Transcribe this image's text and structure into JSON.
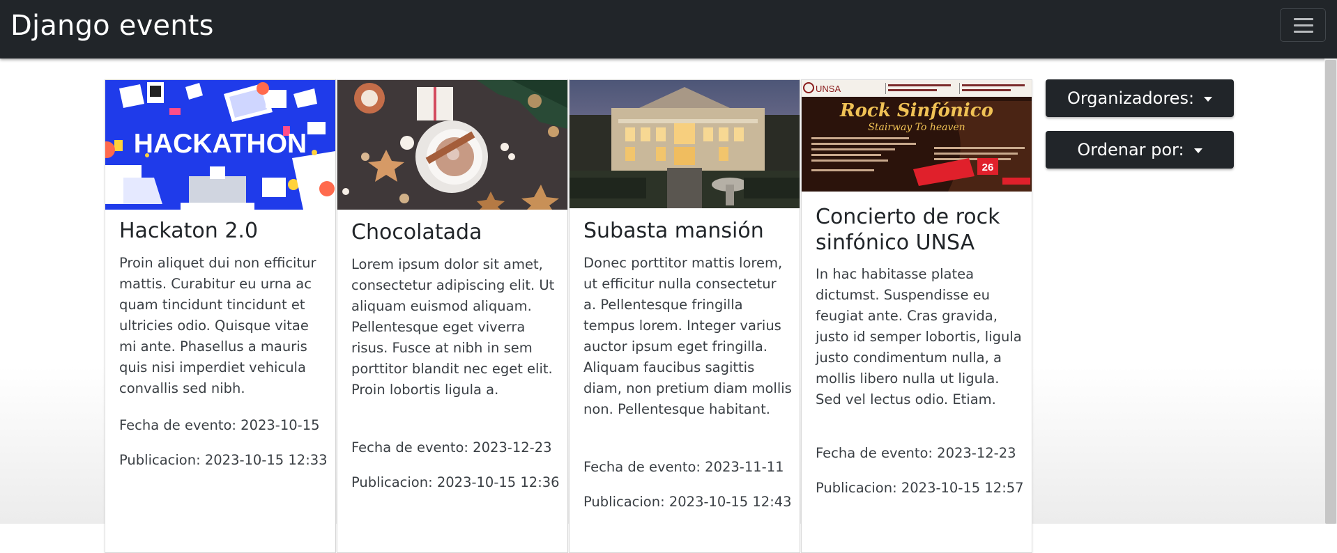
{
  "navbar": {
    "brand": "Django events",
    "toggler_icon": "hamburger-icon"
  },
  "events": [
    {
      "title": "Hackaton 2.0",
      "image": {
        "banner_text": "HACKATHON"
      },
      "description": "Proin aliquet dui non efficitur mattis. Curabitur eu urna ac quam tincidunt tincidunt et ultricies odio. Quisque vitae mi ante. Phasellus a mauris quis nisi imperdiet vehicula convallis sed nibh.",
      "fecha_evento": "Fecha de evento: 2023-10-15",
      "publicacion": "Publicacion: 2023-10-15 12:33"
    },
    {
      "title": "Chocolatada",
      "description": "Lorem ipsum dolor sit amet, consectetur adipiscing elit. Ut aliquam euismod aliquam. Pellentesque eget viverra risus. Fusce at nibh in sem porttitor blandit nec eget elit. Proin lobortis ligula a.",
      "fecha_evento": "Fecha de evento: 2023-12-23",
      "publicacion": "Publicacion: 2023-10-15 12:36"
    },
    {
      "title": "Subasta mansión",
      "description": "Donec porttitor mattis lorem, ut efficitur nulla consectetur a. Pellentesque fringilla tempus lorem. Integer varius auctor ipsum eget fringilla. Aliquam faucibus sagittis diam, non pretium diam mollis non. Pellentesque habitant.",
      "fecha_evento": "Fecha de evento: 2023-11-11",
      "publicacion": "Publicacion: 2023-10-15 12:43"
    },
    {
      "title": "Concierto de rock sinfónico UNSA",
      "image": {
        "poster_title": "Rock Sinfónico",
        "poster_subtitle": "Stairway To heaven",
        "poster_logo": "UNSA",
        "poster_day": "26"
      },
      "description": "In hac habitasse platea dictumst. Suspendisse eu feugiat ante. Cras gravida, justo id semper lobortis, ligula justo condimentum nulla, a mollis libero nulla ut ligula. Sed vel lectus odio. Etiam.",
      "fecha_evento": "Fecha de evento: 2023-12-23",
      "publicacion": "Publicacion: 2023-10-15 12:57"
    }
  ],
  "filters": {
    "organizadores_label": "Organizadores:",
    "ordenar_label": "Ordenar por:"
  },
  "colors": {
    "navbar_bg": "#212529",
    "button_bg": "#212529",
    "hackathon_blue": "#1f3bea"
  }
}
